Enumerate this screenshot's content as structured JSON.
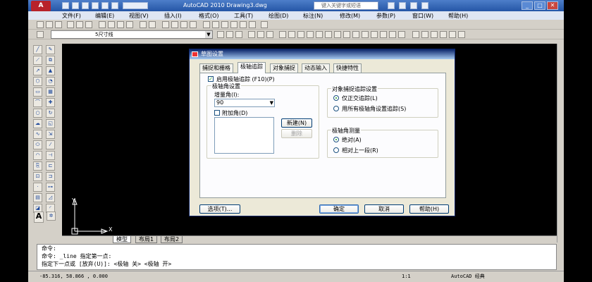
{
  "titlebar": {
    "logo_text": "A",
    "title": "AutoCAD 2010    Drawing3.dwg",
    "search_placeholder": "键入关键字或短语",
    "minimize": "_",
    "restore": "□",
    "close": "✕"
  },
  "menu": [
    "文件(F)",
    "编辑(E)",
    "视图(V)",
    "插入(I)",
    "格式(O)",
    "工具(T)",
    "绘图(D)",
    "标注(N)",
    "修改(M)",
    "参数(P)",
    "窗口(W)",
    "帮助(H)"
  ],
  "layer_dropdown": "5尺寸线",
  "icons": {
    "search": "search-icon",
    "arrow": "chevron-down-icon"
  },
  "drawing": {
    "axis_x": "X",
    "axis_y": "Y"
  },
  "layout_tabs": [
    "模型",
    "布局1",
    "布局2"
  ],
  "command_lines": [
    "命令:",
    "命令: _line 指定第一点:",
    "指定下一点或 [放弃(U)]:  <极轴 关>  <极轴 开>"
  ],
  "status": {
    "coords": "-85.316, 58.866 , 0.000",
    "scale": "1:1",
    "workspace": "AutoCAD 经典"
  },
  "dialog": {
    "title": "草图设置",
    "tabs": [
      "捕捉和栅格",
      "极轴追踪",
      "对象捕捉",
      "动态输入",
      "快捷特性"
    ],
    "enable_polar": "启用极轴追踪 (F10)(P)",
    "polar_angle_group": "极轴角设置",
    "increment_label": "增量角(I):",
    "increment_value": "90",
    "additional_angle": "附加角(D)",
    "new_button": "新建(N)",
    "delete_button": "删除",
    "snap_tracking_group": "对象捕捉追踪设置",
    "orthogonal_only": "仅正交追踪(L)",
    "use_all_polar": "用所有极轴角设置追踪(S)",
    "polar_measure_group": "极轴角测量",
    "absolute": "绝对(A)",
    "relative": "相对上一段(R)",
    "options_button": "选项(T)...",
    "ok_button": "确定",
    "cancel_button": "取消",
    "help_button": "帮助(H)"
  }
}
